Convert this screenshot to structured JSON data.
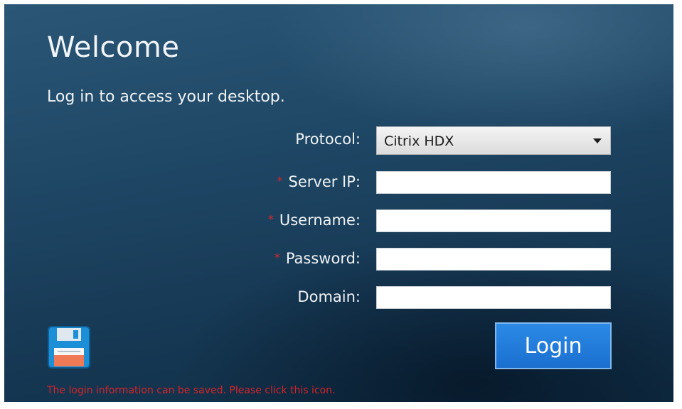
{
  "login": {
    "title": "Welcome",
    "subtitle": "Log in to access your desktop.",
    "required_mark": "*",
    "protocol": {
      "label": "Protocol:",
      "selected": "Citrix HDX"
    },
    "server_ip": {
      "label": "Server IP:",
      "value": ""
    },
    "username": {
      "label": "Username:",
      "value": ""
    },
    "password": {
      "label": "Password:",
      "value": ""
    },
    "domain": {
      "label": "Domain:",
      "value": ""
    },
    "login_button": "Login",
    "save_hint": "The login information can be saved. Please click this icon.",
    "icons": {
      "save": "floppy-disk-icon",
      "dropdown": "chevron-down-icon"
    },
    "colors": {
      "required": "#d9262a",
      "button": "#1f78d8",
      "hint": "#d4242a"
    }
  }
}
